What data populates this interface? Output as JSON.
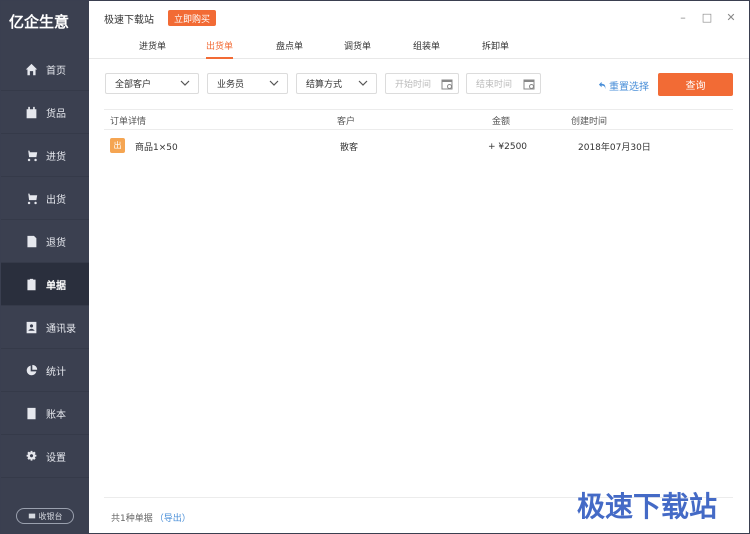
{
  "brand": {
    "logo_text": "亿企生意"
  },
  "header": {
    "title": "极速下载站",
    "buy_label": "立即购买",
    "controls": {
      "minimize": "–",
      "maximize": "□",
      "close": "✕"
    }
  },
  "tabs": [
    {
      "label": "进货单"
    },
    {
      "label": "出货单",
      "active": true
    },
    {
      "label": "盘点单"
    },
    {
      "label": "调货单"
    },
    {
      "label": "组装单"
    },
    {
      "label": "拆卸单"
    }
  ],
  "sidebar": {
    "items": [
      {
        "label": "首页",
        "icon": "home-icon"
      },
      {
        "label": "货品",
        "icon": "box-icon"
      },
      {
        "label": "进货",
        "icon": "cart-in-icon"
      },
      {
        "label": "出货",
        "icon": "cart-out-icon"
      },
      {
        "label": "退货",
        "icon": "return-icon"
      },
      {
        "label": "单据",
        "icon": "document-icon",
        "active": true
      },
      {
        "label": "通讯录",
        "icon": "contacts-icon"
      },
      {
        "label": "统计",
        "icon": "pie-chart-icon"
      },
      {
        "label": "账本",
        "icon": "ledger-icon"
      },
      {
        "label": "设置",
        "icon": "gear-icon"
      }
    ],
    "collapse_label": "收银台"
  },
  "filters": {
    "customer": "全部客户",
    "salesperson": "业务员",
    "settlement": "结算方式",
    "start_date_placeholder": "开始时间",
    "end_date_placeholder": "结束时间",
    "reset_label": "重置选择",
    "query_label": "查询"
  },
  "table": {
    "headers": [
      "订单详情",
      "客户",
      "金额",
      "创建时间"
    ],
    "rows": [
      {
        "tag": "出",
        "detail": "商品1×50",
        "customer": "散客",
        "amount": "+ ¥2500",
        "created": "2018年07月30日"
      }
    ]
  },
  "footer": {
    "count_text": "共1种单据",
    "export_label": "（导出）"
  },
  "watermark": {
    "text": "极速下载站"
  },
  "colors": {
    "accent": "#f26b35",
    "sidebar_bg": "#3b4050",
    "link": "#4a8fd8",
    "tag": "#f5a552"
  }
}
